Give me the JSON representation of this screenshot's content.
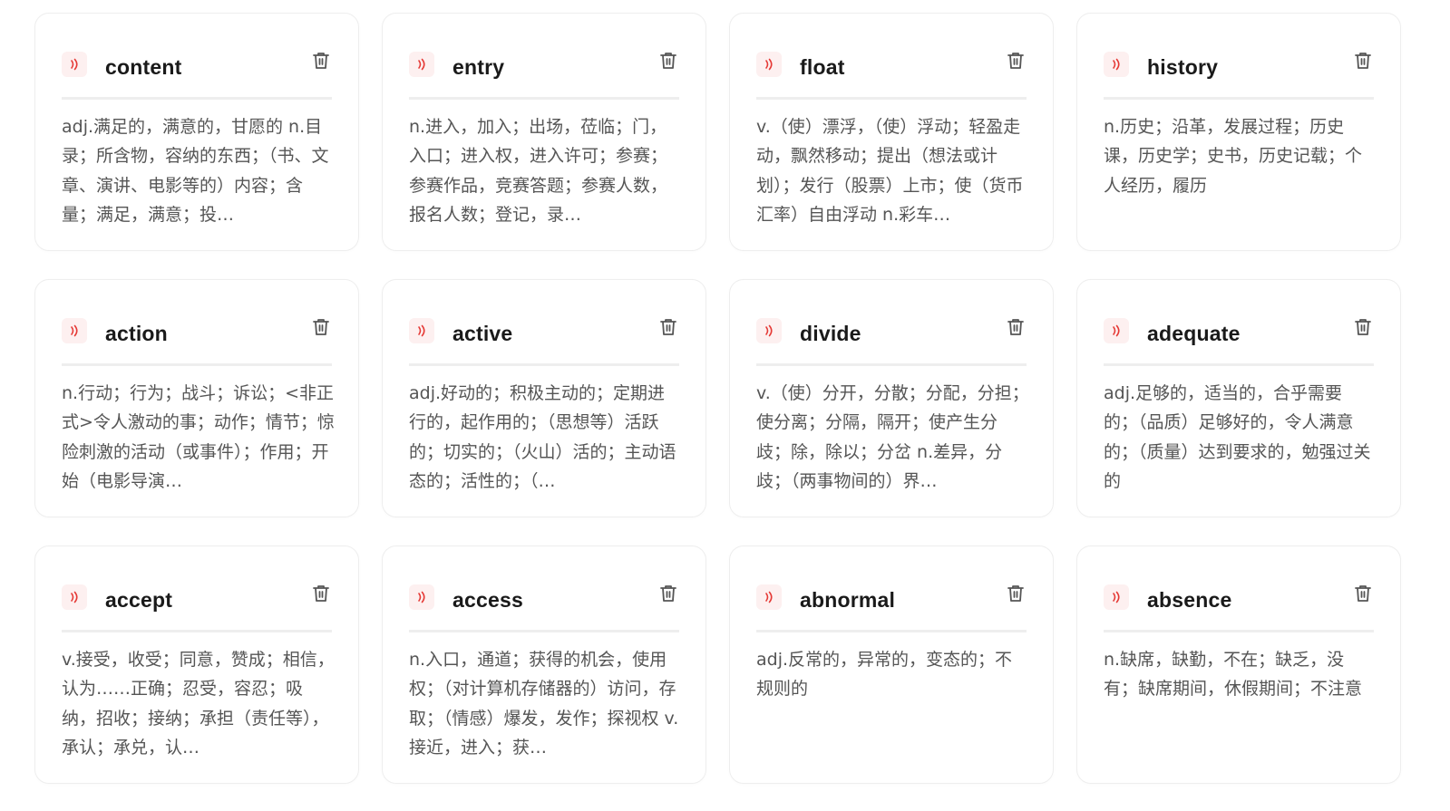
{
  "accent_color": "#e53935",
  "icons": {
    "speaker": "speaker-icon",
    "delete": "trash-icon"
  },
  "cards": [
    {
      "word": "content",
      "meaning": "adj.满足的，满意的，甘愿的 n.目录；所含物，容纳的东西；（书、文章、演讲、电影等的）内容；含量；满足，满意；投…"
    },
    {
      "word": "entry",
      "meaning": "n.进入，加入；出场，莅临；门，入口；进入权，进入许可；参赛；参赛作品，竞赛答题；参赛人数，报名人数；登记，录…"
    },
    {
      "word": "float",
      "meaning": "v.（使）漂浮，（使）浮动；轻盈走动，飘然移动；提出（想法或计划）；发行（股票）上市；使（货币汇率）自由浮动 n.彩车…"
    },
    {
      "word": "history",
      "meaning": "n.历史；沿革，发展过程；历史课，历史学；史书，历史记载；个人经历，履历"
    },
    {
      "word": "action",
      "meaning": "n.行动；行为；战斗；诉讼；<非正式>令人激动的事；动作；情节；惊险刺激的活动（或事件）；作用；开始（电影导演…"
    },
    {
      "word": "active",
      "meaning": "adj.好动的；积极主动的；定期进行的，起作用的；（思想等）活跃的；切实的；（火山）活的；主动语态的；活性的；（…"
    },
    {
      "word": "divide",
      "meaning": "v.（使）分开，分散；分配，分担；使分离；分隔，隔开；使产生分歧；除，除以；分岔 n.差异，分歧；（两事物间的）界…"
    },
    {
      "word": "adequate",
      "meaning": "adj.足够的，适当的，合乎需要的；（品质）足够好的，令人满意的；（质量）达到要求的，勉强过关的"
    },
    {
      "word": "accept",
      "meaning": "v.接受，收受；同意，赞成；相信，认为……正确；忍受，容忍；吸纳，招收；接纳；承担（责任等），承认；承兑，认…"
    },
    {
      "word": "access",
      "meaning": "n.入口，通道；获得的机会，使用权；（对计算机存储器的）访问，存取；（情感）爆发，发作；探视权 v.接近，进入；获…"
    },
    {
      "word": "abnormal",
      "meaning": "adj.反常的，异常的，变态的；不规则的"
    },
    {
      "word": "absence",
      "meaning": "n.缺席，缺勤，不在；缺乏，没有；缺席期间，休假期间；不注意"
    }
  ]
}
